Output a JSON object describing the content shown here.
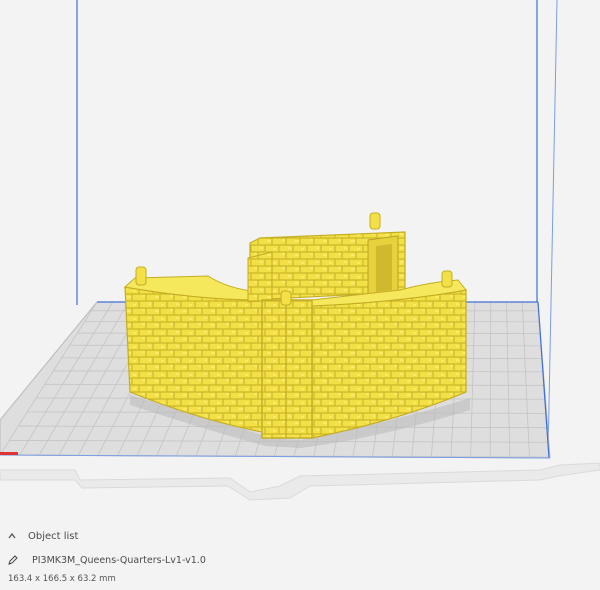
{
  "viewport": {
    "build_plate_color": "#dcdcdc",
    "volume_line_color": "#3f6fd8",
    "grid_color": "#c3c3c3",
    "model_color": "#f5e34a",
    "model_shadow_color": "#d8c52f"
  },
  "object_list": {
    "header_label": "Object list",
    "header_icon": "chevron-up-icon",
    "edit_icon": "pencil-icon",
    "object_name": "PI3MK3M_Queens-Quarters-Lv1-v1.0",
    "dimensions": "163.4 x 166.5 x 63.2 mm"
  }
}
